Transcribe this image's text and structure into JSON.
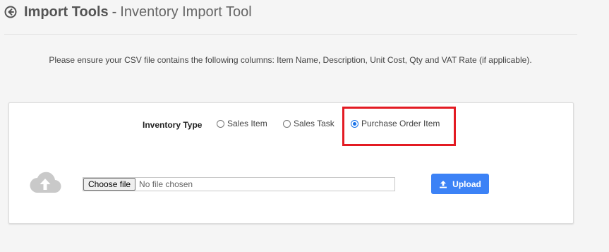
{
  "header": {
    "back_icon": "circle-arrow-left-icon",
    "title_strong": "Import Tools",
    "title_separator": "-",
    "title_light": "Inventory Import Tool"
  },
  "instructions": "Please ensure your CSV file contains the following columns: Item Name, Description, Unit Cost, Qty and VAT Rate (if applicable).",
  "inventory_type": {
    "label": "Inventory Type",
    "options": [
      {
        "label": "Sales Item",
        "checked": false
      },
      {
        "label": "Sales Task",
        "checked": false
      },
      {
        "label": "Purchase Order Item",
        "checked": true
      }
    ]
  },
  "upload": {
    "cloud_icon": "cloud-upload-icon",
    "choose_label": "Choose file",
    "file_status": "No file chosen",
    "button_label": "Upload",
    "button_icon": "upload-icon"
  },
  "colors": {
    "accent": "#3c82f6",
    "highlight": "#e31b23",
    "radio_selected": "#1a73e8"
  }
}
